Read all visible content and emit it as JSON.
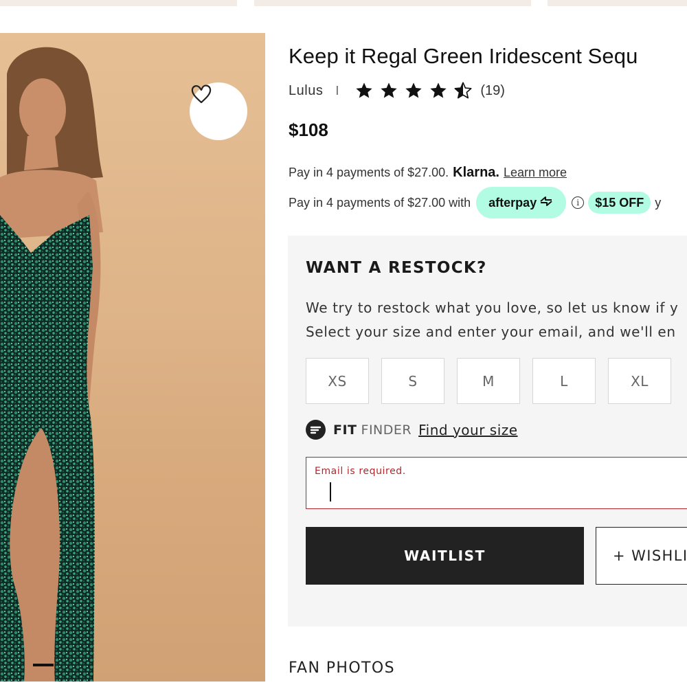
{
  "product": {
    "title": "Keep it Regal Green Iridescent Sequ",
    "brand": "Lulus",
    "separator": "I",
    "rating": 4.5,
    "rating_max": 5,
    "review_count": "(19)",
    "price": "$108"
  },
  "payments": {
    "klarna_text": "Pay in 4 payments of $27.00.",
    "klarna_logo": "Klarna.",
    "klarna_link": "Learn more",
    "afterpay_text": "Pay in 4 payments of $27.00 with",
    "afterpay_logo": "afterpay",
    "info_symbol": "i",
    "discount": "$15 OFF",
    "tail": "y"
  },
  "restock": {
    "title": "WANT A RESTOCK?",
    "desc_line1": "We try to restock what you love, so let us know if y",
    "desc_line2": "Select your size and enter your email, and we'll en",
    "sizes": [
      "XS",
      "S",
      "M",
      "L",
      "XL"
    ],
    "fit_bold": "FIT",
    "fit_light": "FINDER",
    "fit_link": "Find your size",
    "email_error": "Email is required.",
    "email_value": "",
    "waitlist_label": "WAITLIST",
    "wishlist_label": "+ WISHLI"
  },
  "section": {
    "fan_photos": "FAN PHOTOS"
  },
  "colors": {
    "accent_mint": "#b2fce4",
    "error_red": "#b3262b",
    "button_dark": "#222222",
    "panel_bg": "#f5f5f5",
    "dress_green": "#1f4a3c"
  },
  "icons": [
    "heart-icon",
    "star-icon",
    "half-star-icon",
    "afterpay-arrows-icon",
    "info-icon",
    "fit-finder-icon"
  ]
}
